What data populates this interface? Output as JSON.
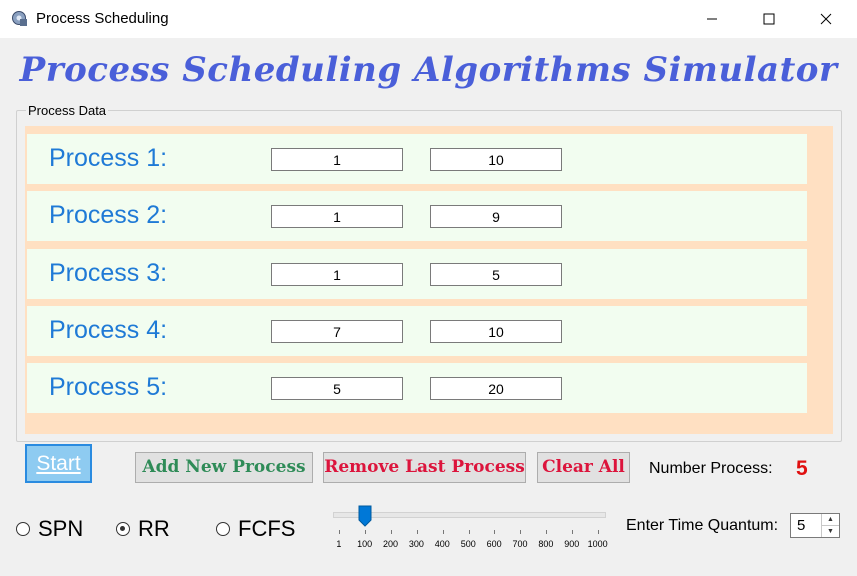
{
  "window": {
    "title": "Process Scheduling",
    "minimize_icon": "minimize-icon",
    "maximize_icon": "maximize-icon",
    "close_icon": "close-icon"
  },
  "header": {
    "title": "Process Scheduling Algorithms Simulator",
    "color": "#4a5fd9"
  },
  "process_data": {
    "group_label": "Process Data",
    "processes": [
      {
        "label": "Process 1:",
        "arrival": "1",
        "burst": "10"
      },
      {
        "label": "Process 2:",
        "arrival": "1",
        "burst": "9"
      },
      {
        "label": "Process 3:",
        "arrival": "1",
        "burst": "5"
      },
      {
        "label": "Process 4:",
        "arrival": "7",
        "burst": "10"
      },
      {
        "label": "Process 5:",
        "arrival": "5",
        "burst": "20"
      }
    ]
  },
  "buttons": {
    "start": "Start",
    "add": "Add New Process",
    "remove": "Remove Last Process",
    "clear": "Clear All"
  },
  "number_process": {
    "label": "Number Process:",
    "value": "5"
  },
  "algorithms": {
    "options": [
      "SPN",
      "RR",
      "FCFS"
    ],
    "selected": "RR"
  },
  "slider": {
    "value": 100,
    "tick_labels": [
      "1",
      "100",
      "200",
      "300",
      "400",
      "500",
      "600",
      "700",
      "800",
      "900",
      "1000"
    ]
  },
  "time_quantum": {
    "label": "Enter Time Quantum:",
    "value": "5"
  },
  "colors": {
    "panel_bg": "#ffe0c2",
    "row_bg": "#f2fdf0",
    "process_label": "#1f7ad6",
    "add_button": "#2e8b57",
    "remove_button": "#dc143c",
    "number_value": "#e01010",
    "start_button": "#8ecbf1"
  }
}
